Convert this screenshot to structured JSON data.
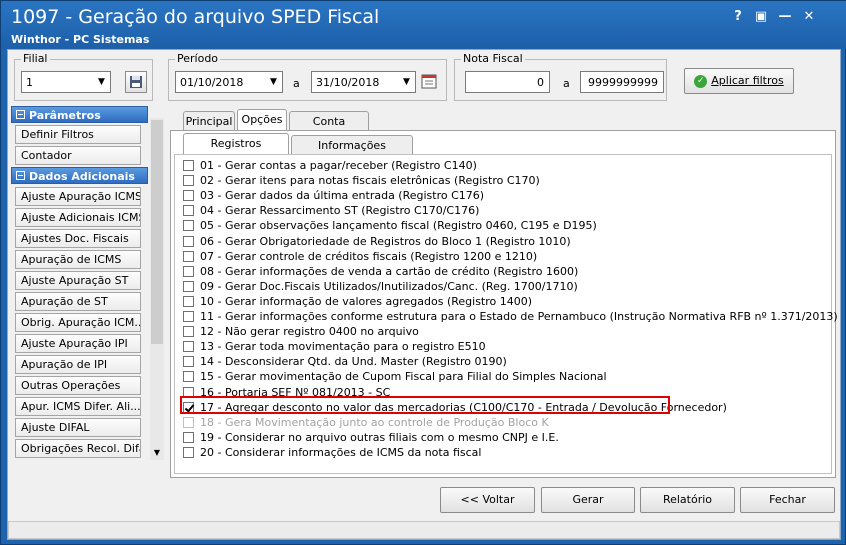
{
  "window": {
    "title": "1097 - Geração do arquivo SPED Fiscal",
    "subtitle": "Winthor - PC Sistemas",
    "help": "?",
    "restore": "▣",
    "minimize": "—",
    "close": "✕"
  },
  "filial": {
    "label": "Filial",
    "value": "1"
  },
  "periodo": {
    "label": "Período",
    "start": "01/10/2018",
    "sep": "a",
    "end": "31/10/2018"
  },
  "nota": {
    "label": "Nota Fiscal",
    "start": "0",
    "sep": "a",
    "end": "9999999999"
  },
  "apply_filters": "Aplicar filtros",
  "sidebar": {
    "cat_params": "Parâmetros",
    "params": [
      "Definir Filtros",
      "Contador"
    ],
    "cat_dados": "Dados Adicionais",
    "dados": [
      "Ajuste Apuração ICMS",
      "Ajuste Adicionais ICMS",
      "Ajustes Doc. Fiscais",
      "Apuração de ICMS",
      "Ajuste Apuração ST",
      "Apuração de ST",
      "Obrig. Apuração ICM...",
      "Ajuste Apuração IPI",
      "Apuração de IPI",
      "Outras Operações",
      "Apur. ICMS Difer. Ali...",
      "Ajuste DIFAL",
      "Obrigações Recol. Difal"
    ]
  },
  "tabs": [
    "Principal",
    "Opções",
    "Conta Contábil"
  ],
  "subtabs": [
    "Registros opcionais",
    "Informações adicionais"
  ],
  "options": [
    {
      "label": "01 - Gerar contas a pagar/receber (Registro C140)",
      "checked": false
    },
    {
      "label": "02 - Gerar itens para notas fiscais eletrônicas (Registro C170)",
      "checked": false
    },
    {
      "label": "03 - Gerar dados da última entrada (Registro C176)",
      "checked": false
    },
    {
      "label": "04 - Gerar Ressarcimento ST (Registro C170/C176)",
      "checked": false
    },
    {
      "label": "05 - Gerar observações lançamento fiscal (Registro 0460, C195 e D195)",
      "checked": false
    },
    {
      "label": "06 - Gerar Obrigatoriedade de Registros do Bloco 1 (Registro  1010)",
      "checked": false
    },
    {
      "label": "07 - Gerar controle de créditos fiscais (Registro 1200 e 1210)",
      "checked": false
    },
    {
      "label": "08 - Gerar informações de venda a cartão de crédito (Registro 1600)",
      "checked": false
    },
    {
      "label": "09 - Gerar Doc.Fiscais Utilizados/Inutilizados/Canc. (Reg. 1700/1710)",
      "checked": false
    },
    {
      "label": "10 - Gerar informação de valores agregados (Registro 1400)",
      "checked": false
    },
    {
      "label": "11 - Gerar informações conforme estrutura para o Estado de Pernambuco (Instrução Normativa RFB nº 1.371/2013)",
      "checked": false
    },
    {
      "label": "12 - Não gerar registro 0400 no arquivo",
      "checked": false
    },
    {
      "label": "13 - Gerar toda movimentação para o registro E510",
      "checked": false
    },
    {
      "label": "14 - Desconsiderar Qtd. da Und. Master (Registro 0190)",
      "checked": false
    },
    {
      "label": "15 - Gerar movimentação de Cupom Fiscal para Filial do Simples Nacional",
      "checked": false
    },
    {
      "label": "16 - Portaria SEF Nº 081/2013 - SC",
      "checked": false
    },
    {
      "label": "17 - Agregar desconto no valor das mercadorias (C100/C170 - Entrada / Devolução Fornecedor)",
      "checked": true
    },
    {
      "label": "18 - Gera Movimentação junto ao controle de Produção Bloco K",
      "checked": false,
      "disabled": true
    },
    {
      "label": "19 - Considerar no arquivo outras filiais com o mesmo CNPJ e I.E.",
      "checked": false
    },
    {
      "label": "20 - Considerar informações de ICMS da nota fiscal",
      "checked": false
    }
  ],
  "buttons": {
    "back": "<< Voltar",
    "generate": "Gerar",
    "report": "Relatório",
    "close": "Fechar"
  },
  "colors": {
    "title_bar": "#1e63ae",
    "category": "#2d6cc0",
    "highlight": "#e00000"
  }
}
